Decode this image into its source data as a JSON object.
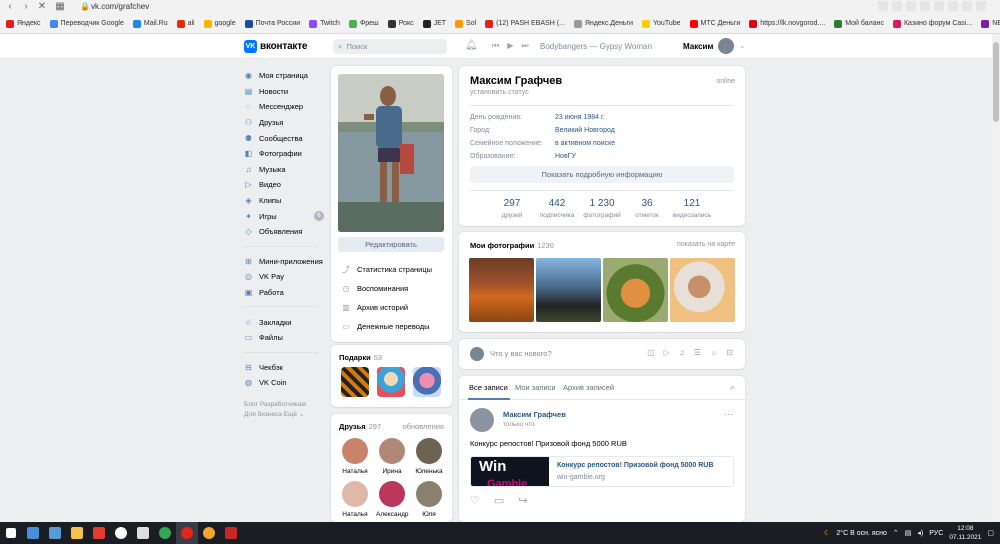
{
  "browser": {
    "url": "vk.com/grafchev",
    "bookmarks": [
      "Яндекс",
      "Переводчик Google",
      "Mail.Ru",
      "ali",
      "google",
      "Почта России",
      "Twitch",
      "Фреш",
      "Рокс",
      "JET",
      "Sol",
      "(12) PASH EBASH (...",
      "Яндекс.Деньги",
      "YouTube",
      "МТС Деньги",
      "https://lk.novgorod....",
      "Мой баланс",
      "Казино форум Casi...",
      "NETELLER » Панель..."
    ],
    "bookmark_colors": [
      "#e21b1b",
      "#4285f4",
      "#168de2",
      "#e62e04",
      "#ffb300",
      "#1e4aa8",
      "#9146ff",
      "#4caf50",
      "#333333",
      "#222222",
      "#ff9800",
      "#e62117",
      "#999999",
      "#ffcc00",
      "#ff0000",
      "#e30611",
      "#2e7d32",
      "#d81b60",
      "#7b1fa2"
    ]
  },
  "header": {
    "logo": "вконтакте",
    "search_placeholder": "Поиск",
    "track": "Bodybangers — Gypsy Woman",
    "user": "Максим"
  },
  "menu": [
    {
      "label": "Моя страница",
      "icon": "user-icon"
    },
    {
      "label": "Новости",
      "icon": "news-icon"
    },
    {
      "label": "Мессенджер",
      "icon": "chat-icon"
    },
    {
      "label": "Друзья",
      "icon": "friends-icon"
    },
    {
      "label": "Сообщества",
      "icon": "groups-icon"
    },
    {
      "label": "Фотографии",
      "icon": "photo-icon"
    },
    {
      "label": "Музыка",
      "icon": "music-icon"
    },
    {
      "label": "Видео",
      "icon": "video-icon"
    },
    {
      "label": "Клипы",
      "icon": "clips-icon"
    },
    {
      "label": "Игры",
      "icon": "games-icon",
      "badge": "6"
    },
    {
      "label": "Объявления",
      "icon": "ads-icon"
    },
    {
      "label": "Мини-приложения",
      "icon": "apps-icon"
    },
    {
      "label": "VK Pay",
      "icon": "pay-icon"
    },
    {
      "label": "Работа",
      "icon": "work-icon"
    },
    {
      "label": "Закладки",
      "icon": "bookmark-icon"
    },
    {
      "label": "Файлы",
      "icon": "files-icon"
    },
    {
      "label": "Чекбэк",
      "icon": "checkback-icon"
    },
    {
      "label": "VK Coin",
      "icon": "coin-icon"
    }
  ],
  "footer_links": {
    "line1": "Блог   Разработчикам",
    "line2": "Для бизнеса   Ещё ⌄"
  },
  "profile": {
    "edit_button": "Редактировать",
    "links": [
      {
        "label": "Статистика страницы",
        "icon": "stats-icon"
      },
      {
        "label": "Воспоминания",
        "icon": "memories-icon"
      },
      {
        "label": "Архив историй",
        "icon": "archive-icon"
      },
      {
        "label": "Денежные переводы",
        "icon": "money-icon"
      }
    ],
    "name": "Максим Графчев",
    "online": "online",
    "status": "установить статус",
    "info": [
      {
        "label": "День рождения:",
        "value": "23 июня 1984 г."
      },
      {
        "label": "Город:",
        "value": "Великий Новгород"
      },
      {
        "label": "Семейное положение:",
        "value": "в активном поиске"
      },
      {
        "label": "Образование:",
        "value": "НовГУ"
      }
    ],
    "more_button": "Показать подробную информацию",
    "counters": [
      {
        "num": "297",
        "label": "друзей"
      },
      {
        "num": "442",
        "label": "подписчика"
      },
      {
        "num": "1 230",
        "label": "фотографий"
      },
      {
        "num": "36",
        "label": "отметок"
      },
      {
        "num": "121",
        "label": "видеозапись"
      }
    ]
  },
  "gifts": {
    "title": "Подарки",
    "count": "53"
  },
  "friends": {
    "title": "Друзья",
    "count": "297",
    "updates": "обновления",
    "list": [
      "Наталья",
      "Ирина",
      "Юленька",
      "Наталья",
      "Александр",
      "Юля"
    ]
  },
  "photos": {
    "title": "Мои фотографии",
    "count": "1230",
    "map_link": "показать на карте"
  },
  "composer": {
    "placeholder": "Что у вас нового?"
  },
  "wall": {
    "tabs": [
      "Все записи",
      "Мои записи",
      "Архив записей"
    ],
    "post": {
      "author": "Максим Графчев",
      "time": "только что",
      "text": "Конкурс репостов! Призовой фонд 5000 RUB",
      "link_title": "Конкурс репостов! Призовой фонд 5000 RUB",
      "link_domain": "win-gamble.org",
      "link_image_text": "Win",
      "link_image_subtext": "Gamble"
    }
  },
  "taskbar": {
    "weather": "2°C  В осн. ясно",
    "lang": "РУС",
    "time": "12:08",
    "date": "07.11.2021"
  },
  "colors": {
    "accent": "#0077ff",
    "link": "#2a5885",
    "background": "#edeef0"
  }
}
